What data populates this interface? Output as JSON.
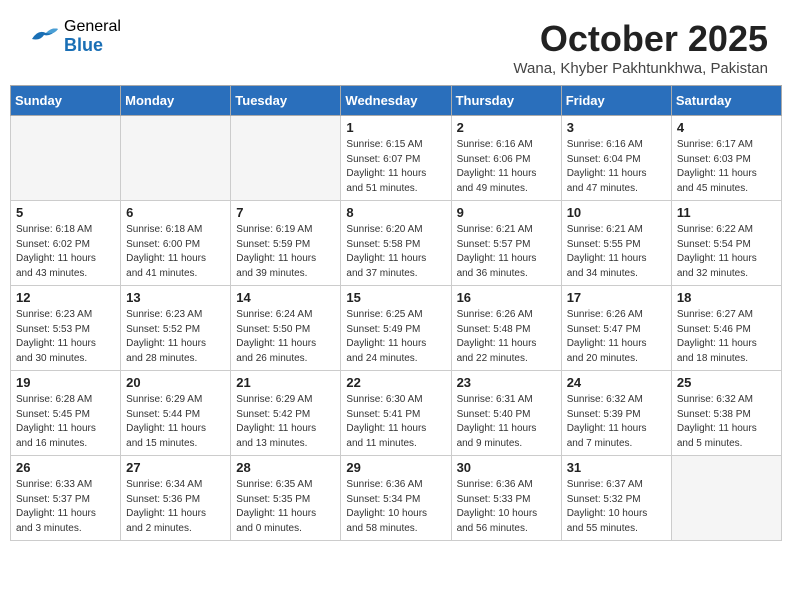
{
  "header": {
    "logo_general": "General",
    "logo_blue": "Blue",
    "month_title": "October 2025",
    "location": "Wana, Khyber Pakhtunkhwa, Pakistan"
  },
  "weekdays": [
    "Sunday",
    "Monday",
    "Tuesday",
    "Wednesday",
    "Thursday",
    "Friday",
    "Saturday"
  ],
  "weeks": [
    [
      {
        "day": "",
        "info": ""
      },
      {
        "day": "",
        "info": ""
      },
      {
        "day": "",
        "info": ""
      },
      {
        "day": "1",
        "info": "Sunrise: 6:15 AM\nSunset: 6:07 PM\nDaylight: 11 hours\nand 51 minutes."
      },
      {
        "day": "2",
        "info": "Sunrise: 6:16 AM\nSunset: 6:06 PM\nDaylight: 11 hours\nand 49 minutes."
      },
      {
        "day": "3",
        "info": "Sunrise: 6:16 AM\nSunset: 6:04 PM\nDaylight: 11 hours\nand 47 minutes."
      },
      {
        "day": "4",
        "info": "Sunrise: 6:17 AM\nSunset: 6:03 PM\nDaylight: 11 hours\nand 45 minutes."
      }
    ],
    [
      {
        "day": "5",
        "info": "Sunrise: 6:18 AM\nSunset: 6:02 PM\nDaylight: 11 hours\nand 43 minutes."
      },
      {
        "day": "6",
        "info": "Sunrise: 6:18 AM\nSunset: 6:00 PM\nDaylight: 11 hours\nand 41 minutes."
      },
      {
        "day": "7",
        "info": "Sunrise: 6:19 AM\nSunset: 5:59 PM\nDaylight: 11 hours\nand 39 minutes."
      },
      {
        "day": "8",
        "info": "Sunrise: 6:20 AM\nSunset: 5:58 PM\nDaylight: 11 hours\nand 37 minutes."
      },
      {
        "day": "9",
        "info": "Sunrise: 6:21 AM\nSunset: 5:57 PM\nDaylight: 11 hours\nand 36 minutes."
      },
      {
        "day": "10",
        "info": "Sunrise: 6:21 AM\nSunset: 5:55 PM\nDaylight: 11 hours\nand 34 minutes."
      },
      {
        "day": "11",
        "info": "Sunrise: 6:22 AM\nSunset: 5:54 PM\nDaylight: 11 hours\nand 32 minutes."
      }
    ],
    [
      {
        "day": "12",
        "info": "Sunrise: 6:23 AM\nSunset: 5:53 PM\nDaylight: 11 hours\nand 30 minutes."
      },
      {
        "day": "13",
        "info": "Sunrise: 6:23 AM\nSunset: 5:52 PM\nDaylight: 11 hours\nand 28 minutes."
      },
      {
        "day": "14",
        "info": "Sunrise: 6:24 AM\nSunset: 5:50 PM\nDaylight: 11 hours\nand 26 minutes."
      },
      {
        "day": "15",
        "info": "Sunrise: 6:25 AM\nSunset: 5:49 PM\nDaylight: 11 hours\nand 24 minutes."
      },
      {
        "day": "16",
        "info": "Sunrise: 6:26 AM\nSunset: 5:48 PM\nDaylight: 11 hours\nand 22 minutes."
      },
      {
        "day": "17",
        "info": "Sunrise: 6:26 AM\nSunset: 5:47 PM\nDaylight: 11 hours\nand 20 minutes."
      },
      {
        "day": "18",
        "info": "Sunrise: 6:27 AM\nSunset: 5:46 PM\nDaylight: 11 hours\nand 18 minutes."
      }
    ],
    [
      {
        "day": "19",
        "info": "Sunrise: 6:28 AM\nSunset: 5:45 PM\nDaylight: 11 hours\nand 16 minutes."
      },
      {
        "day": "20",
        "info": "Sunrise: 6:29 AM\nSunset: 5:44 PM\nDaylight: 11 hours\nand 15 minutes."
      },
      {
        "day": "21",
        "info": "Sunrise: 6:29 AM\nSunset: 5:42 PM\nDaylight: 11 hours\nand 13 minutes."
      },
      {
        "day": "22",
        "info": "Sunrise: 6:30 AM\nSunset: 5:41 PM\nDaylight: 11 hours\nand 11 minutes."
      },
      {
        "day": "23",
        "info": "Sunrise: 6:31 AM\nSunset: 5:40 PM\nDaylight: 11 hours\nand 9 minutes."
      },
      {
        "day": "24",
        "info": "Sunrise: 6:32 AM\nSunset: 5:39 PM\nDaylight: 11 hours\nand 7 minutes."
      },
      {
        "day": "25",
        "info": "Sunrise: 6:32 AM\nSunset: 5:38 PM\nDaylight: 11 hours\nand 5 minutes."
      }
    ],
    [
      {
        "day": "26",
        "info": "Sunrise: 6:33 AM\nSunset: 5:37 PM\nDaylight: 11 hours\nand 3 minutes."
      },
      {
        "day": "27",
        "info": "Sunrise: 6:34 AM\nSunset: 5:36 PM\nDaylight: 11 hours\nand 2 minutes."
      },
      {
        "day": "28",
        "info": "Sunrise: 6:35 AM\nSunset: 5:35 PM\nDaylight: 11 hours\nand 0 minutes."
      },
      {
        "day": "29",
        "info": "Sunrise: 6:36 AM\nSunset: 5:34 PM\nDaylight: 10 hours\nand 58 minutes."
      },
      {
        "day": "30",
        "info": "Sunrise: 6:36 AM\nSunset: 5:33 PM\nDaylight: 10 hours\nand 56 minutes."
      },
      {
        "day": "31",
        "info": "Sunrise: 6:37 AM\nSunset: 5:32 PM\nDaylight: 10 hours\nand 55 minutes."
      },
      {
        "day": "",
        "info": ""
      }
    ]
  ]
}
